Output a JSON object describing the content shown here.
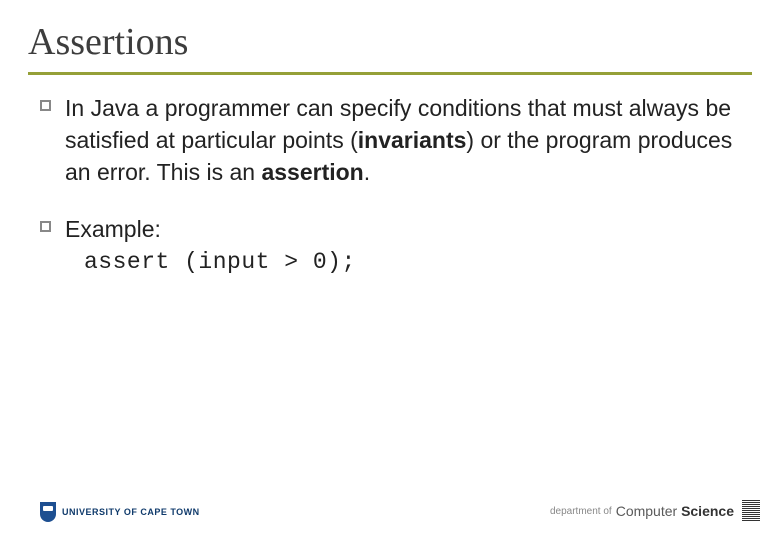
{
  "title": "Assertions",
  "bullets": [
    {
      "pre": "In Java a programmer can specify conditions that must always be satisfied at particular points (",
      "bold1": "invariants",
      "mid": ") or the program produces an error.  This is an ",
      "bold2": "assertion",
      "post": "."
    },
    {
      "text": "Example:"
    }
  ],
  "code": "assert (input > 0);",
  "footer": {
    "left": "UNIVERSITY OF CAPE TOWN",
    "right_small": "department of",
    "right_main_a": "Computer ",
    "right_main_b": "Science"
  }
}
